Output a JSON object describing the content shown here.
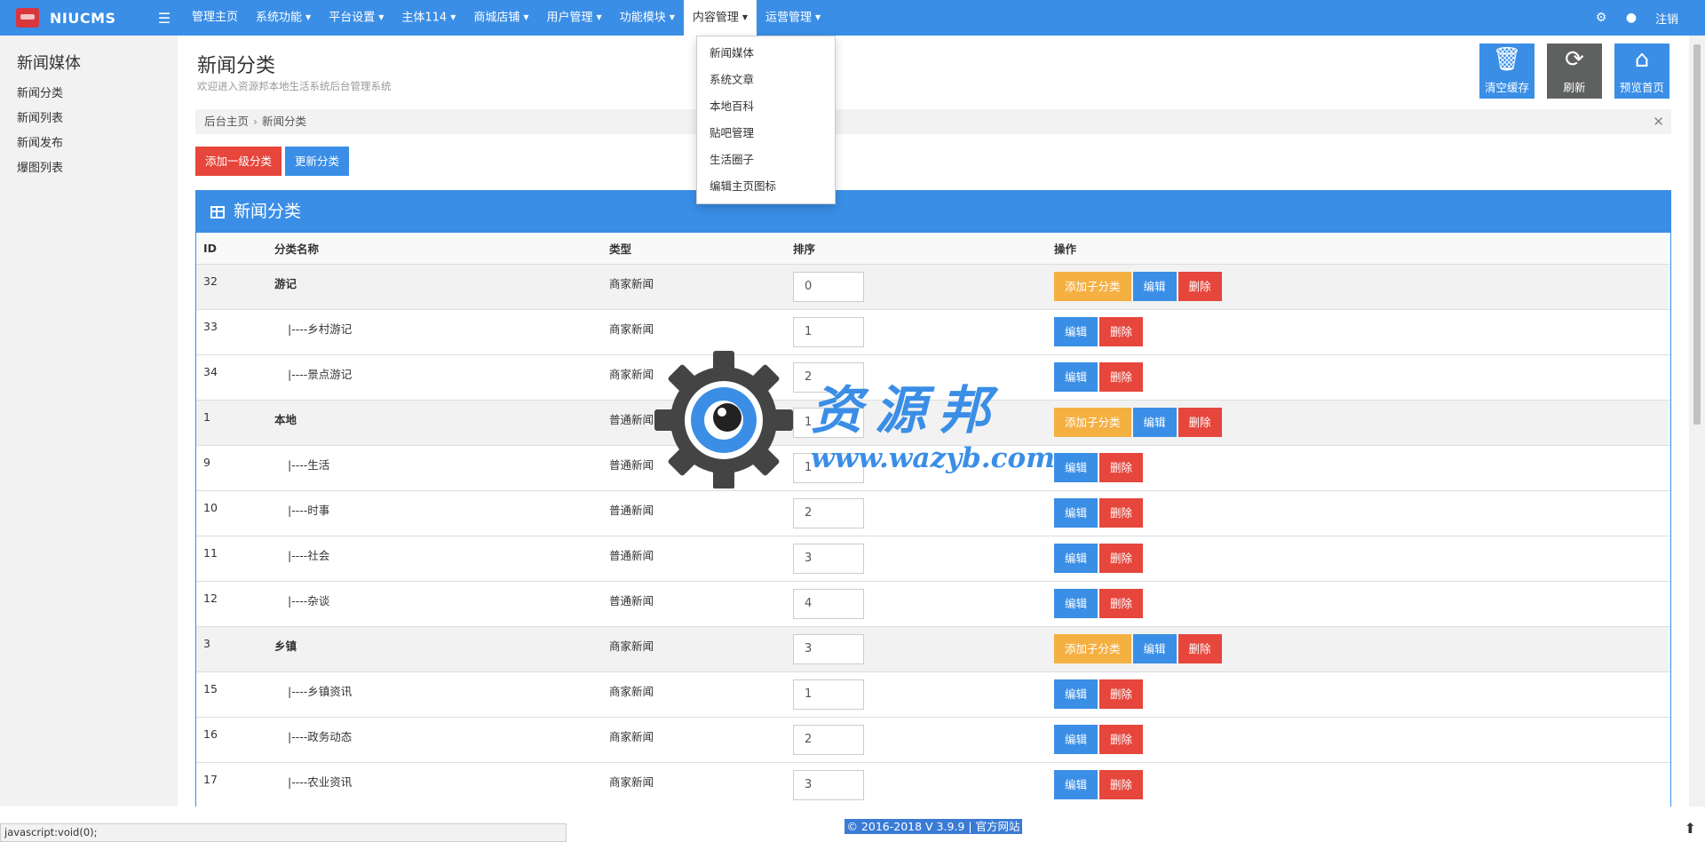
{
  "nav": {
    "brand": "NIUCMS",
    "items": [
      {
        "label": "管理主页",
        "caret": false
      },
      {
        "label": "系统功能",
        "caret": true
      },
      {
        "label": "平台设置",
        "caret": true
      },
      {
        "label": "主体114",
        "caret": true
      },
      {
        "label": "商城店铺",
        "caret": true
      },
      {
        "label": "用户管理",
        "caret": true
      },
      {
        "label": "功能模块",
        "caret": true
      },
      {
        "label": "内容管理",
        "caret": true,
        "active": true
      },
      {
        "label": "运营管理",
        "caret": true
      }
    ],
    "logout": "注销",
    "dropdown": [
      "新闻媒体",
      "系统文章",
      "本地百科",
      "贴吧管理",
      "生活圈子",
      "编辑主页图标"
    ]
  },
  "sidebar": {
    "title": "新闻媒体",
    "items": [
      "新闻分类",
      "新闻列表",
      "新闻发布",
      "爆图列表"
    ]
  },
  "page": {
    "title": "新闻分类",
    "subtitle": "欢迎进入资源邦本地生活系统后台管理系统",
    "top_buttons": [
      "清空缓存",
      "刷新",
      "预览首页"
    ],
    "breadcrumb": [
      "后台主页",
      "新闻分类"
    ],
    "add_button": "添加一级分类",
    "update_button": "更新分类"
  },
  "table": {
    "title": "新闻分类",
    "headers": [
      "ID",
      "分类名称",
      "类型",
      "排序",
      "操作"
    ],
    "op_labels": {
      "add_sub": "添加子分类",
      "edit": "编辑",
      "delete": "删除"
    },
    "rows": [
      {
        "id": "32",
        "name": "游记",
        "type": "商家新闻",
        "sort": "0",
        "parent": true
      },
      {
        "id": "33",
        "name": "|----乡村游记",
        "type": "商家新闻",
        "sort": "1",
        "parent": false
      },
      {
        "id": "34",
        "name": "|----景点游记",
        "type": "商家新闻",
        "sort": "2",
        "parent": false
      },
      {
        "id": "1",
        "name": "本地",
        "type": "普通新闻",
        "sort": "1",
        "parent": true
      },
      {
        "id": "9",
        "name": "|----生活",
        "type": "普通新闻",
        "sort": "1",
        "parent": false
      },
      {
        "id": "10",
        "name": "|----时事",
        "type": "普通新闻",
        "sort": "2",
        "parent": false
      },
      {
        "id": "11",
        "name": "|----社会",
        "type": "普通新闻",
        "sort": "3",
        "parent": false
      },
      {
        "id": "12",
        "name": "|----杂谈",
        "type": "普通新闻",
        "sort": "4",
        "parent": false
      },
      {
        "id": "3",
        "name": "乡镇",
        "type": "商家新闻",
        "sort": "3",
        "parent": true
      },
      {
        "id": "15",
        "name": "|----乡镇资讯",
        "type": "商家新闻",
        "sort": "1",
        "parent": false
      },
      {
        "id": "16",
        "name": "|----政务动态",
        "type": "商家新闻",
        "sort": "2",
        "parent": false
      },
      {
        "id": "17",
        "name": "|----农业资讯",
        "type": "商家新闻",
        "sort": "3",
        "parent": false
      }
    ]
  },
  "watermark": {
    "cn": "资源邦",
    "url": "www.wazyb.com"
  },
  "footer": "© 2016-2018 V 3.9.9 | 官方网站",
  "status_url": "javascript:void(0);",
  "colors": {
    "primary": "#3a8ee6",
    "danger": "#e6463c",
    "warning": "#f5b042",
    "dark": "#5f6060"
  }
}
